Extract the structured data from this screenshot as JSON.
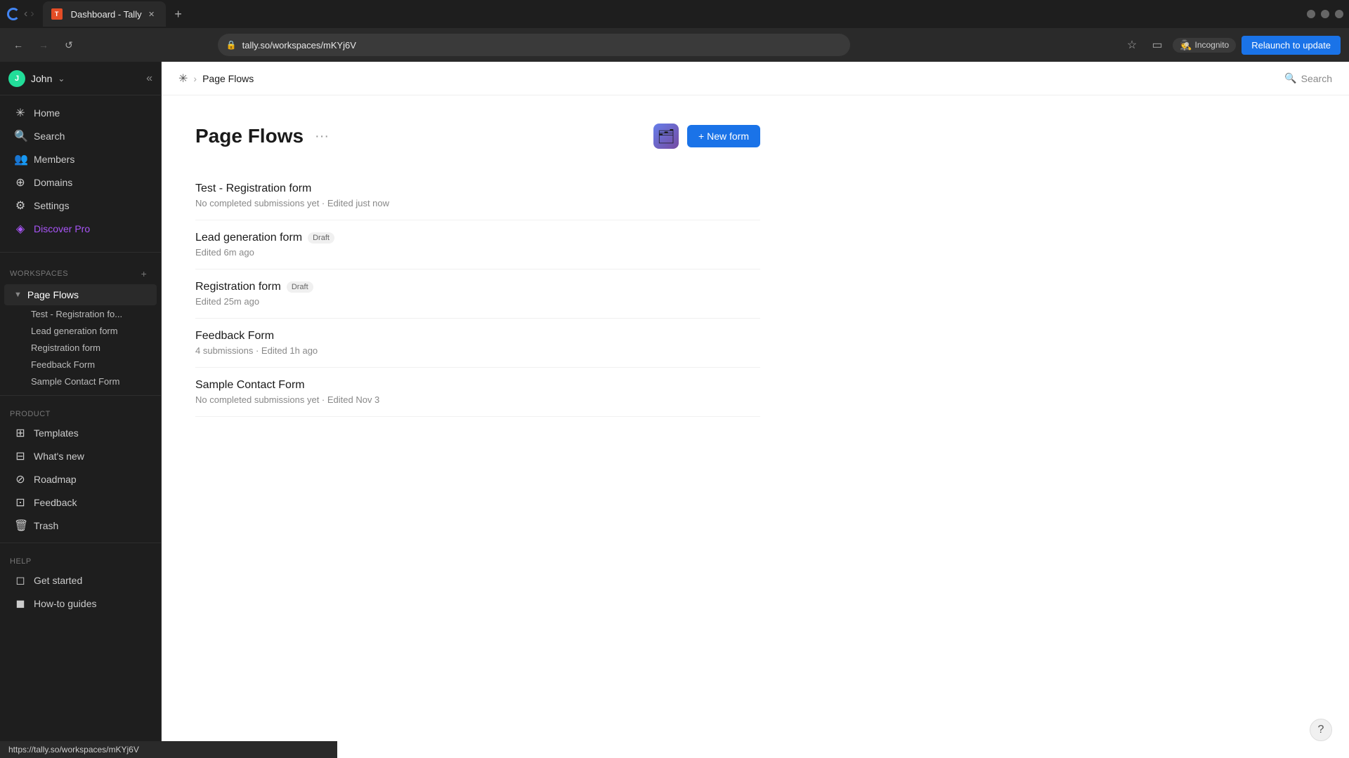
{
  "browser": {
    "tab_title": "Dashboard - Tally",
    "url": "tally.so/workspaces/mKYj6V",
    "status_url": "https://tally.so/workspaces/mKYj6V",
    "relaunch_label": "Relaunch to update",
    "incognito_label": "Incognito",
    "new_tab_symbol": "+"
  },
  "header": {
    "breadcrumb_icon": "✳",
    "breadcrumb_page": "Page Flows",
    "search_label": "Search"
  },
  "sidebar": {
    "user_name": "John",
    "user_initial": "J",
    "nav_items": [
      {
        "id": "home",
        "icon": "✳",
        "label": "Home"
      },
      {
        "id": "search",
        "icon": "○",
        "label": "Search"
      },
      {
        "id": "members",
        "icon": "◯",
        "label": "Members"
      },
      {
        "id": "domains",
        "icon": "⊕",
        "label": "Domains"
      },
      {
        "id": "settings",
        "icon": "⚙",
        "label": "Settings"
      },
      {
        "id": "discover-pro",
        "icon": "◈",
        "label": "Discover Pro"
      }
    ],
    "workspaces_label": "Workspaces",
    "workspace_name": "Page Flows",
    "sub_items": [
      "Test - Registration fo...",
      "Lead generation form",
      "Registration form",
      "Feedback Form",
      "Sample Contact Form"
    ],
    "product_label": "Product",
    "product_items": [
      {
        "id": "templates",
        "icon": "⊞",
        "label": "Templates"
      },
      {
        "id": "whats-new",
        "icon": "⊟",
        "label": "What's new"
      },
      {
        "id": "roadmap",
        "icon": "⊘",
        "label": "Roadmap"
      },
      {
        "id": "feedback",
        "icon": "⊡",
        "label": "Feedback"
      },
      {
        "id": "trash",
        "icon": "🗑",
        "label": "Trash"
      }
    ],
    "help_label": "Help",
    "help_items": [
      {
        "id": "get-started",
        "icon": "◻",
        "label": "Get started"
      },
      {
        "id": "how-to-guides",
        "icon": "◼",
        "label": "How-to guides"
      }
    ]
  },
  "page": {
    "title": "Page Flows",
    "new_form_label": "+ New form",
    "menu_dots": "···",
    "forms": [
      {
        "name": "Test - Registration form",
        "draft": false,
        "meta": "No completed submissions yet · Edited just now"
      },
      {
        "name": "Lead generation form",
        "draft": true,
        "meta": "Edited 6m ago"
      },
      {
        "name": "Registration form",
        "draft": true,
        "meta": "Edited 25m ago"
      },
      {
        "name": "Feedback Form",
        "draft": false,
        "meta": "4 submissions · Edited 1h ago"
      },
      {
        "name": "Sample Contact Form",
        "draft": false,
        "meta": "No completed submissions yet · Edited Nov 3"
      }
    ],
    "draft_badge_label": "Draft"
  },
  "status_bar": {
    "url": "https://tally.so/workspaces/mKYj6V"
  }
}
